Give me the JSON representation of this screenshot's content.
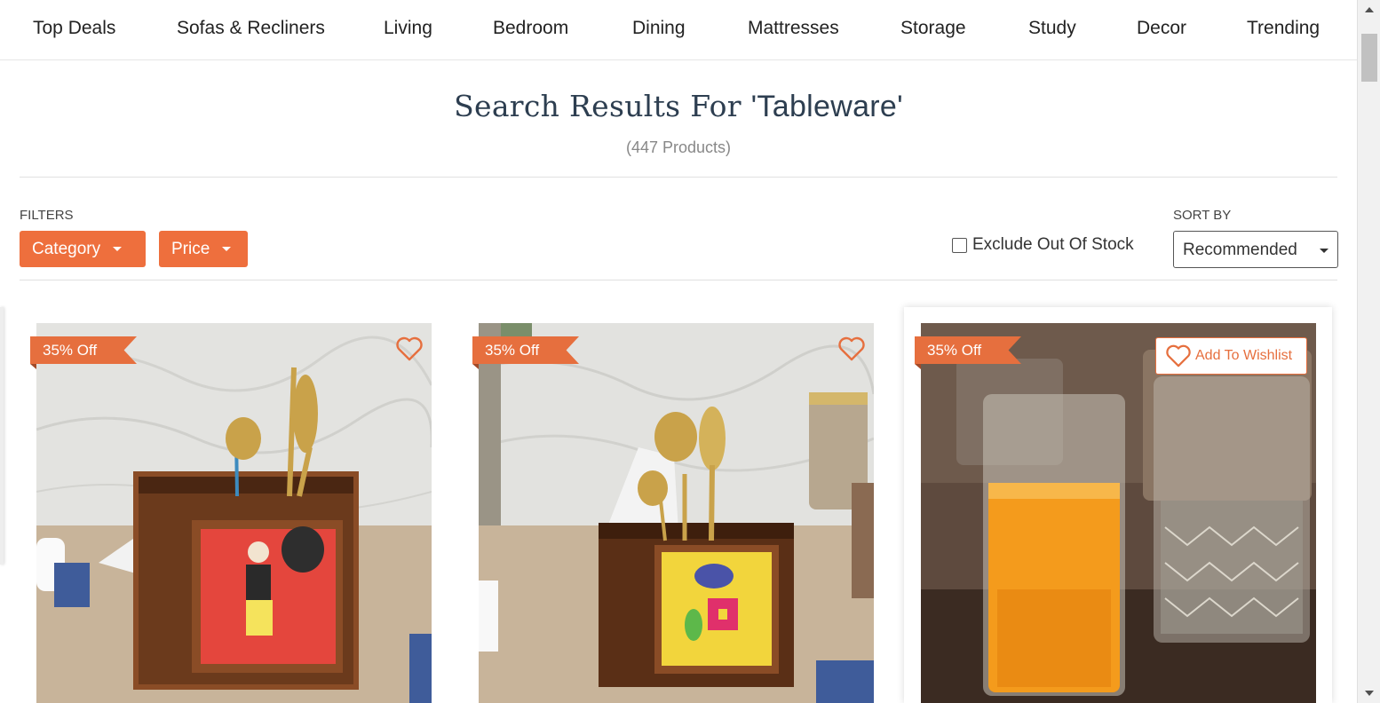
{
  "nav": {
    "items": [
      "Top Deals",
      "Sofas & Recliners",
      "Living",
      "Bedroom",
      "Dining",
      "Mattresses",
      "Storage",
      "Study",
      "Decor",
      "Trending"
    ]
  },
  "search": {
    "title_prefix": "Search Results For",
    "query": "'Tableware'",
    "count": "(447 Products)"
  },
  "filters": {
    "label": "FILTERS",
    "category": "Category",
    "price": "Price",
    "exclude_out_of_stock": "Exclude Out Of Stock",
    "exclude_checked": false
  },
  "sort": {
    "label": "SORT BY",
    "selected": "Recommended"
  },
  "products": [
    {
      "discount": "35% Off",
      "image": "wooden cutlery holder with red painted panel and gold spoons"
    },
    {
      "discount": "35% Off",
      "image": "wooden cutlery holder with yellow bird panel and gold cutlery"
    },
    {
      "discount": "35% Off",
      "image": "glass tumblers with orange juice",
      "wishlist_label": "Add To Wishlist"
    }
  ],
  "colors": {
    "accent": "#ee6f3d",
    "title": "#2d3e50"
  }
}
